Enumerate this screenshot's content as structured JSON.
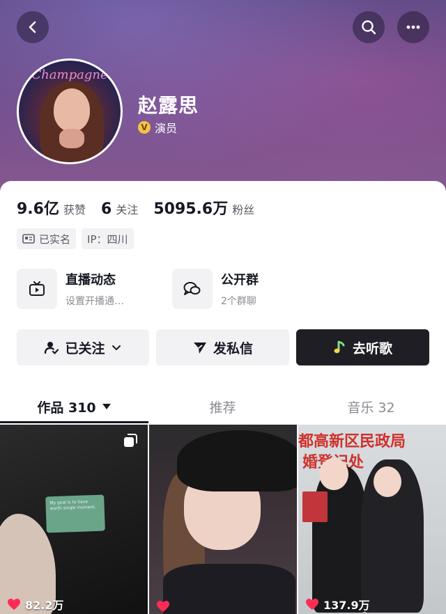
{
  "header": {
    "name": "赵露思",
    "role": "演员",
    "avatar_caption": "Champagne",
    "verified_badge": "V"
  },
  "stats": [
    {
      "value": "9.6亿",
      "label": "获赞"
    },
    {
      "value": "6",
      "label": "关注"
    },
    {
      "value": "5095.6万",
      "label": "粉丝"
    }
  ],
  "tags": [
    {
      "label": "已实名",
      "icon": "id-card-icon"
    },
    {
      "label": "IP：四川",
      "icon": ""
    }
  ],
  "features": [
    {
      "title": "直播动态",
      "subtitle": "设置开播通…",
      "icon": "tv-icon"
    },
    {
      "title": "公开群",
      "subtitle": "2个群聊",
      "icon": "chat-bubbles-icon"
    }
  ],
  "actions": {
    "follow": "已关注",
    "message": "发私信",
    "music": "去听歌"
  },
  "tabs": [
    {
      "label": "作品 310"
    },
    {
      "label": "推荐"
    },
    {
      "label": "音乐 32"
    }
  ],
  "videos": [
    {
      "likes": "82.2万"
    },
    {
      "likes": ""
    },
    {
      "likes": "137.9万"
    }
  ],
  "thumb_text": {
    "card_text": "My goal is to have worth single moment.",
    "sign_line1": "都高新区民政局",
    "sign_line2": "婚登记处"
  },
  "colors": {
    "accent_dark": "#1f1e25",
    "like_red": "#fe2c55",
    "badge_gold": "#f5c342"
  }
}
